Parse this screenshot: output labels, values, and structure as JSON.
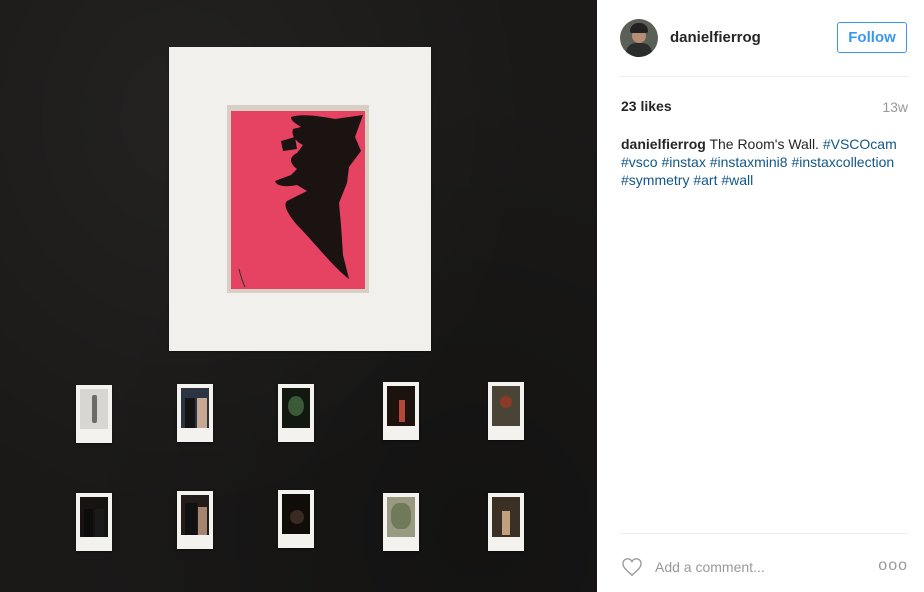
{
  "post": {
    "username": "danielfierrog",
    "follow_label": "Follow",
    "likes": "23 likes",
    "time_ago": "13w",
    "caption": {
      "user": "danielfierrog",
      "text": "The Room's Wall.",
      "tags": [
        "#VSCOcam",
        "#vsco",
        "#instax",
        "#instaxmini8",
        "#instaxcollection",
        "#symmetry",
        "#art",
        "#wall"
      ]
    },
    "comment_placeholder": "Add a comment...",
    "more_label": "ooo"
  },
  "colors": {
    "accent": "#3897f0",
    "hashtag": "#125688",
    "print_red": "#e64261",
    "wall": "#1a1918"
  },
  "icons": {
    "like": "heart-outline-icon",
    "more": "more-options-icon"
  }
}
